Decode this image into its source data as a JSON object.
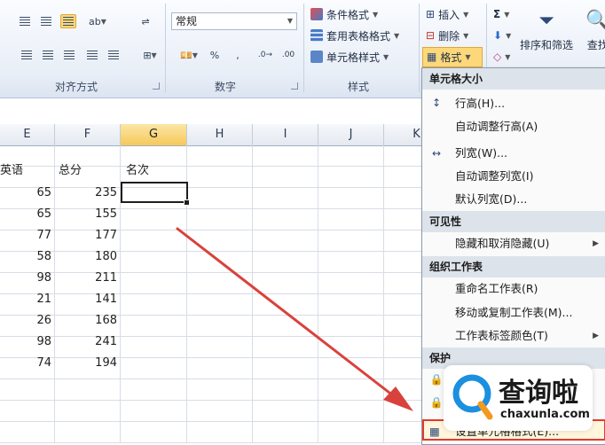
{
  "ribbon": {
    "number_format": "常规",
    "align_group_label": "对齐方式",
    "number_group_label": "数字",
    "style_group_label": "样式",
    "percent": "%",
    "comma": ",",
    "cond_format": "条件格式",
    "table_format": "套用表格格式",
    "cell_style": "单元格样式",
    "insert": "插入",
    "delete": "删除",
    "format": "格式",
    "sigma": "Σ",
    "sort_filter": "排序和筛选",
    "find": "查找"
  },
  "columns": [
    "E",
    "F",
    "G",
    "H",
    "I",
    "J",
    "K"
  ],
  "table": {
    "header_e": "英语",
    "header_f": "总分",
    "header_g": "名次",
    "rows": [
      {
        "e": "65",
        "f": "235"
      },
      {
        "e": "65",
        "f": "155"
      },
      {
        "e": "77",
        "f": "177"
      },
      {
        "e": "58",
        "f": "180"
      },
      {
        "e": "98",
        "f": "211"
      },
      {
        "e": "21",
        "f": "141"
      },
      {
        "e": "26",
        "f": "168"
      },
      {
        "e": "98",
        "f": "241"
      },
      {
        "e": "74",
        "f": "194"
      }
    ]
  },
  "menu": {
    "cell_size": "单元格大小",
    "row_height": "行高(H)...",
    "autofit_row": "自动调整行高(A)",
    "col_width": "列宽(W)...",
    "autofit_col": "自动调整列宽(I)",
    "default_width": "默认列宽(D)...",
    "visibility": "可见性",
    "hide_unhide": "隐藏和取消隐藏(U)",
    "organize": "组织工作表",
    "rename": "重命名工作表(R)",
    "move_copy": "移动或复制工作表(M)...",
    "tab_color": "工作表标签颜色(T)",
    "protect": "保护",
    "format_cells": "设置单元格格式(E)..."
  },
  "watermark": {
    "brand": "查询啦",
    "url": "chaxunla.com"
  },
  "colors": {
    "accent": "#fcd87a",
    "arrow": "#d9423c",
    "highlight_border": "#e23b2e"
  }
}
